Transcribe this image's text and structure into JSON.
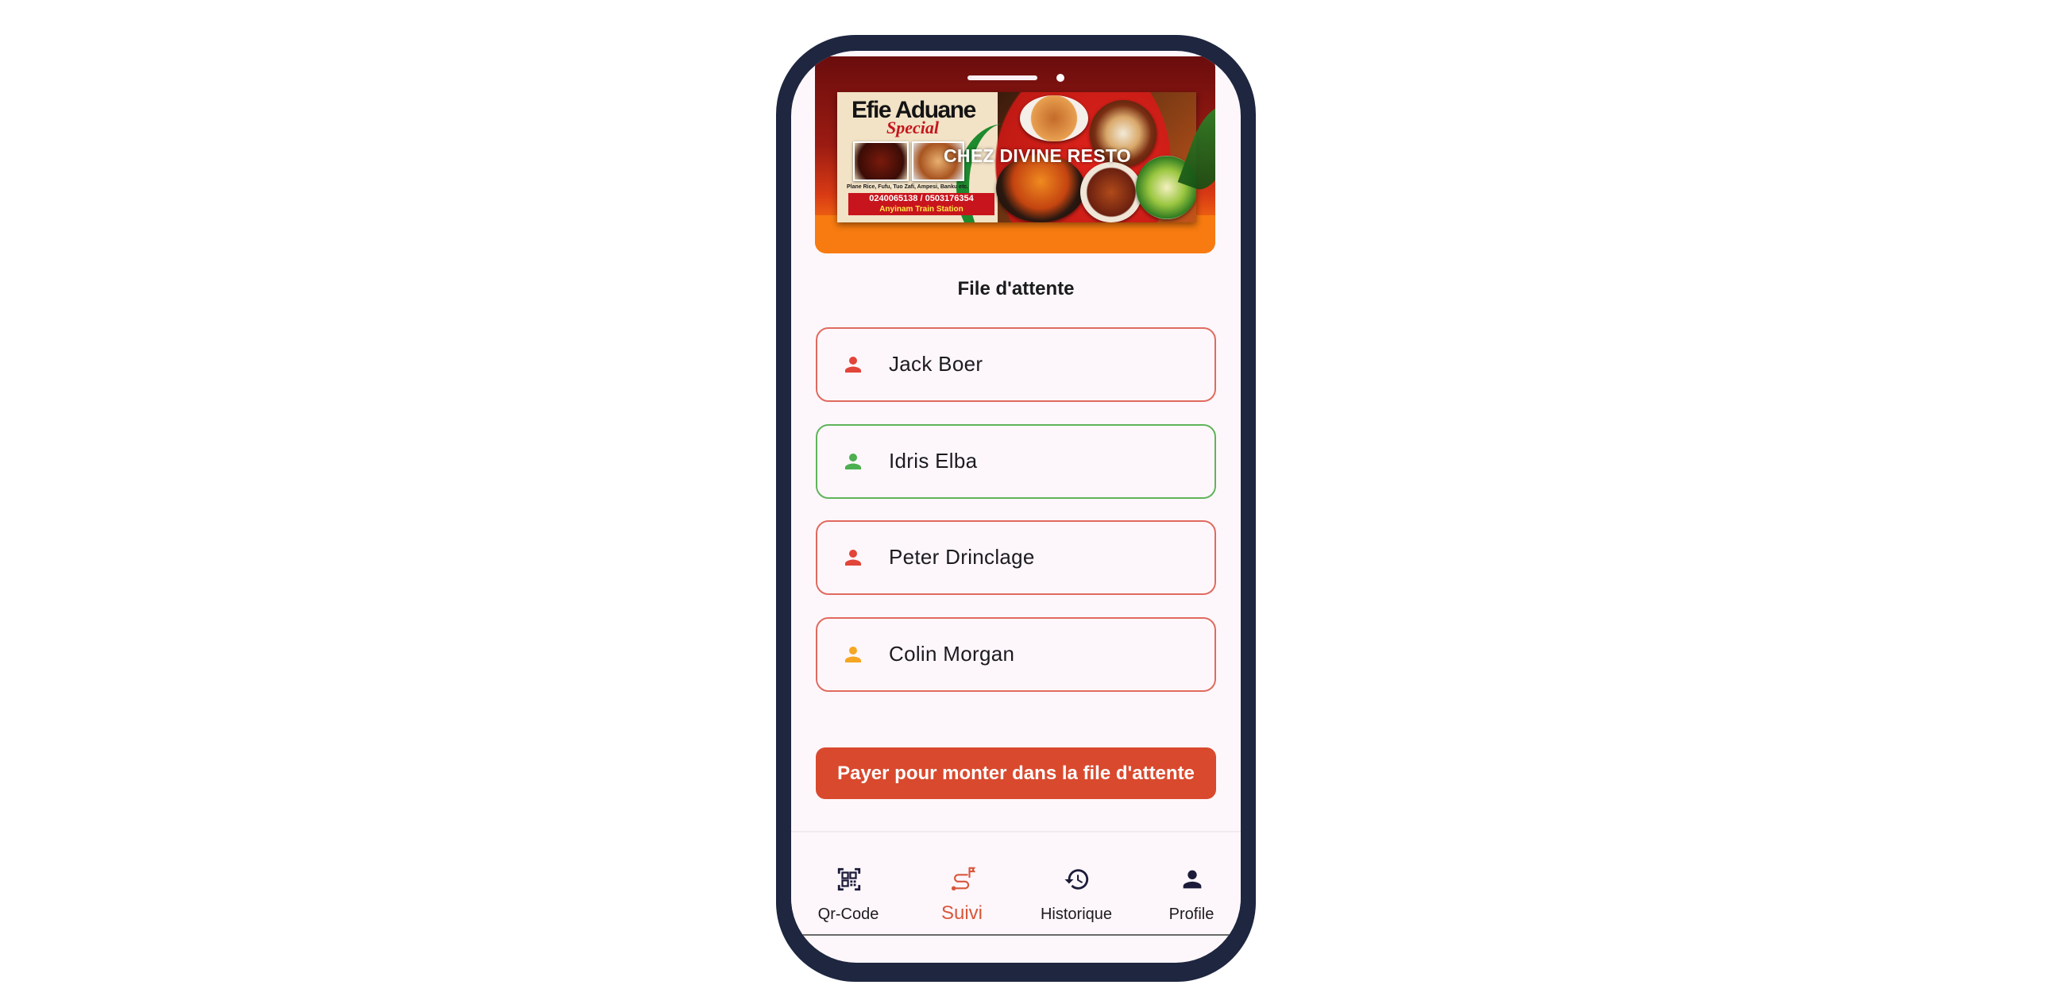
{
  "banner": {
    "card_title": "Efie Aduane",
    "card_subtitle": "Special",
    "card_menu": "Plane Rice, Fufu, Tuo Zafi, Ampesi, Banku etc.",
    "card_phone": "0240065138 / 0503176354",
    "card_location": "Anyinam Train Station",
    "overlay_title": "CHEZ DIVINE RESTO"
  },
  "queue": {
    "title": "File d'attente",
    "items": [
      {
        "name": "Jack Boer",
        "icon_color": "#e2453a",
        "border_color": "#e06a5f"
      },
      {
        "name": "Idris Elba",
        "icon_color": "#4caf50",
        "border_color": "#5fb45a"
      },
      {
        "name": "Peter Drinclage",
        "icon_color": "#e2453a",
        "border_color": "#e06a5f"
      },
      {
        "name": "Colin Morgan",
        "icon_color": "#f5a623",
        "border_color": "#e06a5f"
      }
    ],
    "icon": "person-icon"
  },
  "pay_button": {
    "label": "Payer pour monter dans la file d'attente",
    "color": "#d9492e"
  },
  "bottom_nav": {
    "items": [
      {
        "label": "Qr-Code",
        "icon": "qr-code-scan-icon",
        "active": false
      },
      {
        "label": "Suivi",
        "icon": "route-tracking-icon",
        "active": true
      },
      {
        "label": "Historique",
        "icon": "history-icon",
        "active": false
      },
      {
        "label": "Profile",
        "icon": "person-icon",
        "active": false
      }
    ],
    "active_color": "#d9573d",
    "inactive_color": "#1d1b3a"
  }
}
